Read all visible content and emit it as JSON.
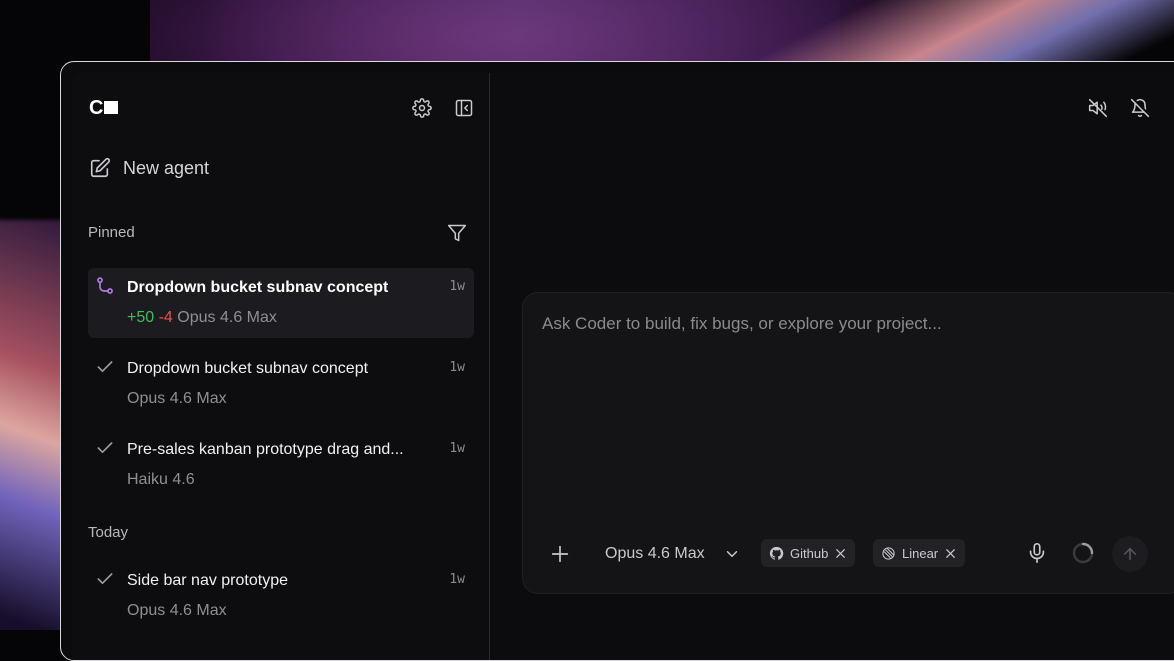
{
  "app": {
    "logo_text": "C"
  },
  "sidebar": {
    "new_agent_label": "New agent",
    "sections": {
      "pinned": "Pinned",
      "today": "Today"
    },
    "items": [
      {
        "title": "Dropdown bucket subnav concept",
        "time": "1w",
        "added": "+50",
        "removed": "-4",
        "model": "Opus 4.6 Max",
        "status_icon": "git-branch-icon",
        "active": true
      },
      {
        "title": "Dropdown bucket subnav concept",
        "time": "1w",
        "model": "Opus 4.6 Max",
        "status_icon": "check-icon"
      },
      {
        "title": "Pre-sales kanban prototype drag and...",
        "time": "1w",
        "model": "Haiku 4.6",
        "status_icon": "check-icon"
      },
      {
        "title": "Side bar nav prototype",
        "time": "1w",
        "model": "Opus 4.6 Max",
        "status_icon": "check-icon"
      }
    ]
  },
  "composer": {
    "placeholder": "Ask Coder to build, fix bugs, or explore your project...",
    "model": "Opus 4.6 Max",
    "chips": [
      {
        "label": "Github",
        "icon": "github-icon"
      },
      {
        "label": "Linear",
        "icon": "linear-icon"
      }
    ]
  },
  "colors": {
    "accent_purple": "#b47be8",
    "added_green": "#3fbf5a",
    "removed_red": "#e5534b"
  }
}
